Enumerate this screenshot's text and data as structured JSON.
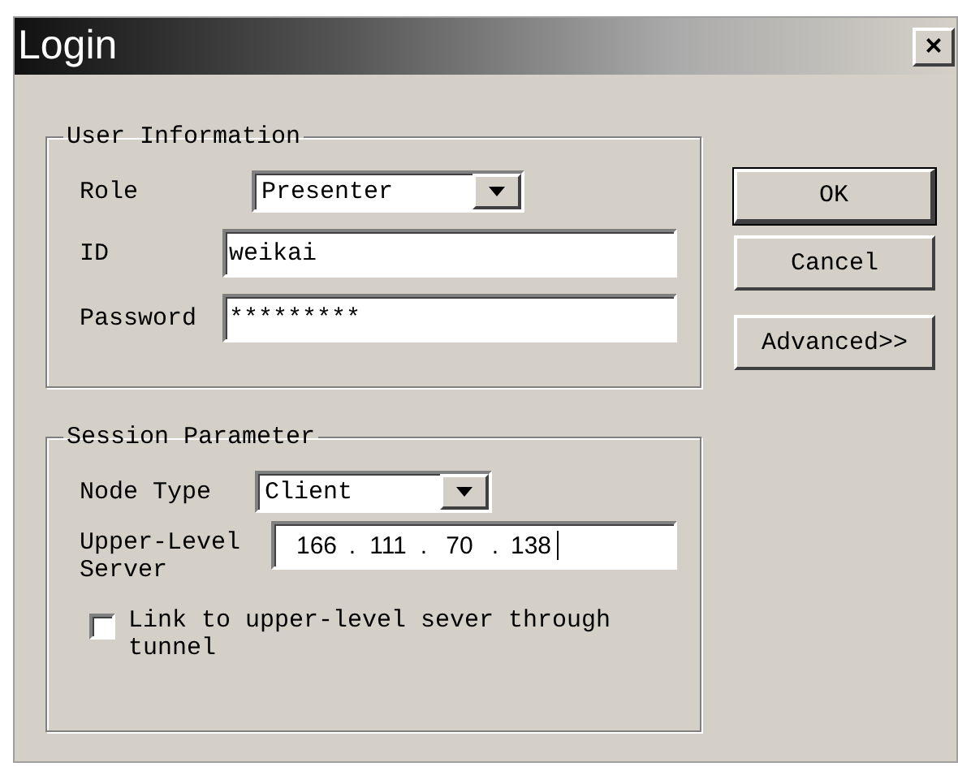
{
  "window": {
    "title": "Login",
    "close": "×"
  },
  "user_information": {
    "title": "User Information",
    "role": {
      "label": "Role",
      "value": "Presenter"
    },
    "id": {
      "label": "ID",
      "value": "weikai"
    },
    "password": {
      "label": "Password",
      "value": "*********"
    }
  },
  "session_parameter": {
    "title": "Session Parameter",
    "node_type": {
      "label": "Node Type",
      "value": "Client"
    },
    "upper_level_server": {
      "label": "Upper-Level Server",
      "octets": [
        "166",
        "111",
        "70",
        "138"
      ],
      "separators": [
        ".",
        ".",
        "."
      ]
    },
    "tunnel": {
      "label": "Link to upper-level sever through tunnel",
      "checked": false
    }
  },
  "buttons": [
    {
      "label": "OK",
      "default": true
    },
    {
      "label": "Cancel",
      "default": false
    },
    {
      "label": "Advanced>>",
      "default": false
    }
  ]
}
